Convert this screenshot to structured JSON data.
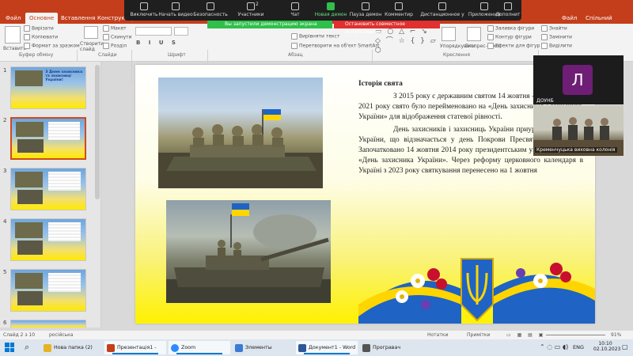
{
  "ribbon": {
    "tabs": [
      "Файл",
      "Основне",
      "Вставлення",
      "Конструктор"
    ],
    "right_tabs": [
      "Файл",
      "Спільний доступ"
    ],
    "clipboard": {
      "paste": "Вставити",
      "cut": "Вирізати",
      "copy": "Копіювати",
      "format": "Формат за зразком",
      "group": "Буфер обміну"
    },
    "slides": {
      "new": "Створити слайд",
      "layout": "Макет",
      "reset": "Скинути",
      "section": "Розділ",
      "group": "Слайди"
    },
    "font_group": "Шрифт",
    "paragraph": {
      "align_text": "Вирівняти текст",
      "smartart": "Перетворити на об'єкт SmartArt",
      "group": "Абзац"
    },
    "drawing": {
      "arrange": "Упорядкувати",
      "styles": "Експрес-стилі",
      "fill": "Заливка фігури",
      "outline": "Контур фігури",
      "effects": "Ефекти для фігур",
      "group": "Креслення"
    },
    "editing": {
      "find": "Знайти",
      "replace": "Замінити",
      "select": "Виділити"
    }
  },
  "zoom_toolbar": {
    "buttons": [
      "Виключить",
      "Начать видео",
      "Безопасность",
      "Участники",
      "Чат",
      "Новая демон",
      "Пауза демон",
      "Комментир",
      "Дистанционное у",
      "Приложения",
      "Дополнит"
    ],
    "participants_count": "2",
    "share_notice": "Вы запустили демонстрацию экрана",
    "stop_share": "Остановить совместное использование"
  },
  "thumbnails": [
    {
      "num": "1",
      "title": "З Днем захисника та захисниці України!"
    },
    {
      "num": "2",
      "title": ""
    },
    {
      "num": "3",
      "title": ""
    },
    {
      "num": "4",
      "title": ""
    },
    {
      "num": "5",
      "title": ""
    },
    {
      "num": "6",
      "title": ""
    }
  ],
  "slide": {
    "heading": "Історія свята",
    "paragraph1": "З 2015 року є державним святом 14 жовтня - днем. У серпні 2021 року свято було перейменовано на «День захисників і захисниць України» для відображення статевої рівності.",
    "paragraph2": "День захисників і захисниць України приурочено на свято України, що відзначається у день Покрови Пресвятої Богородиці. Започатковано 14 жовтня 2014 року президентським указом із назвою «День захисника України». Через реформу церковного календаря в Україні з 2023 року святкування перенесено на 1 жовтня"
  },
  "participants": [
    {
      "initial": "Л",
      "name": "ДОУНБ"
    },
    {
      "name": "Кременчуцька виховна колонія"
    }
  ],
  "status_bar": {
    "slide": "Слайд 2 з 10",
    "language": "російська",
    "notes": "Нотатки",
    "comments": "Примітки",
    "zoom": "91%"
  },
  "taskbar": {
    "items": [
      {
        "label": "Нова папка (2)",
        "color": "#e6b422"
      },
      {
        "label": "Презентація1 - Po...",
        "color": "#c43e1c"
      },
      {
        "label": "Zoom",
        "color": "#2d8cff"
      },
      {
        "label": "Элементы управл...",
        "color": "#3a7bd5"
      },
      {
        "label": "Документ1 - Word",
        "color": "#2b579a"
      },
      {
        "label": "Програвач Windo...",
        "color": "#555555"
      }
    ],
    "lang": "ENG",
    "time": "10:10",
    "date": "02.10.2023"
  }
}
